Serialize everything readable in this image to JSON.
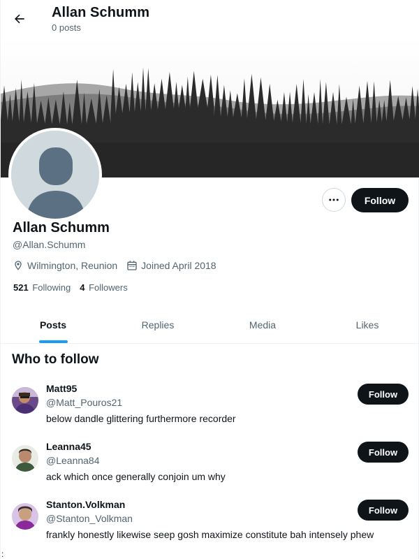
{
  "header": {
    "title": "Allan Schumm",
    "subtitle": "0 posts"
  },
  "profile": {
    "name": "Allan Schumm",
    "handle": "@Allan.Schumm",
    "location": "Wilmington, Reunion",
    "joined": "Joined April 2018",
    "following_count": "521",
    "following_label": "Following",
    "followers_count": "4",
    "followers_label": "Followers",
    "follow_label": "Follow",
    "more_icon": "ellipsis-icon"
  },
  "tabs": [
    {
      "label": "Posts",
      "active": true
    },
    {
      "label": "Replies",
      "active": false
    },
    {
      "label": "Media",
      "active": false
    },
    {
      "label": "Likes",
      "active": false
    }
  ],
  "who_to_follow": {
    "title": "Who to follow",
    "users": [
      {
        "name": "Matt95",
        "handle": "@Matt_Pouros21",
        "bio": "below dandle glittering furthermore recorder",
        "follow_label": "Follow"
      },
      {
        "name": "Leanna45",
        "handle": "@Leanna84",
        "bio": "ack which once generally conjoin um why",
        "follow_label": "Follow"
      },
      {
        "name": "Stanton.Volkman",
        "handle": "@Stanton_Volkman",
        "bio": "frankly honestly likewise seep gosh maximize constitute bah intensely phew",
        "follow_label": "Follow"
      }
    ]
  },
  "corner_mark": ":",
  "colors": {
    "text": "#0f1419",
    "secondary": "#536471",
    "accent": "#1d9bf0",
    "button": "#0f1419",
    "border": "#eff3f4"
  }
}
